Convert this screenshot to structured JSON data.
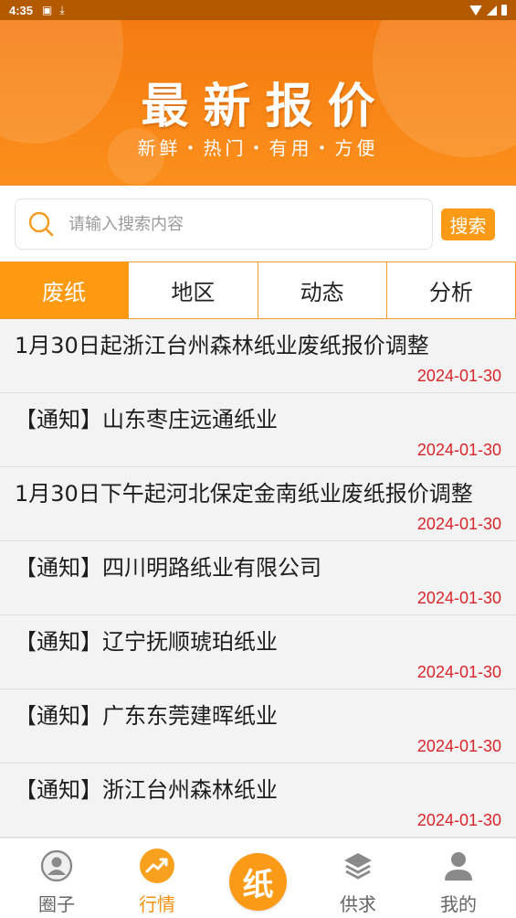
{
  "status_bar": {
    "time": "4:35",
    "left_icons": [
      "photo-icon",
      "download-icon"
    ],
    "right_icons": [
      "wifi-icon",
      "signal-icon",
      "battery-icon"
    ]
  },
  "banner": {
    "title": "最新报价",
    "subtitle": "新鲜・热门・有用・方便"
  },
  "search": {
    "placeholder": "请输入搜索内容",
    "value": "",
    "button_label": "搜索"
  },
  "tabs": [
    {
      "label": "废纸",
      "active": true
    },
    {
      "label": "地区",
      "active": false
    },
    {
      "label": "动态",
      "active": false
    },
    {
      "label": "分析",
      "active": false
    }
  ],
  "news": [
    {
      "title": "1月30日起浙江台州森林纸业废纸报价调整",
      "date": "2024-01-30"
    },
    {
      "title": "【通知】山东枣庄远通纸业",
      "date": "2024-01-30"
    },
    {
      "title": "1月30日下午起河北保定金南纸业废纸报价调整",
      "date": "2024-01-30"
    },
    {
      "title": "【通知】四川明路纸业有限公司",
      "date": "2024-01-30"
    },
    {
      "title": "【通知】辽宁抚顺琥珀纸业",
      "date": "2024-01-30"
    },
    {
      "title": "【通知】广东东莞建晖纸业",
      "date": "2024-01-30"
    },
    {
      "title": "【通知】浙江台州森林纸业",
      "date": "2024-01-30"
    }
  ],
  "bottom_nav": {
    "items": [
      {
        "label": "圈子",
        "icon": "circle-user-icon",
        "active": false
      },
      {
        "label": "行情",
        "icon": "trend-icon",
        "active": true
      },
      {
        "label": "供求",
        "icon": "layers-icon",
        "active": false
      },
      {
        "label": "我的",
        "icon": "profile-icon",
        "active": false
      }
    ],
    "center_label": "纸"
  },
  "colors": {
    "accent": "#fb9a16",
    "date": "#d6262b",
    "banner": "#f57b10"
  }
}
